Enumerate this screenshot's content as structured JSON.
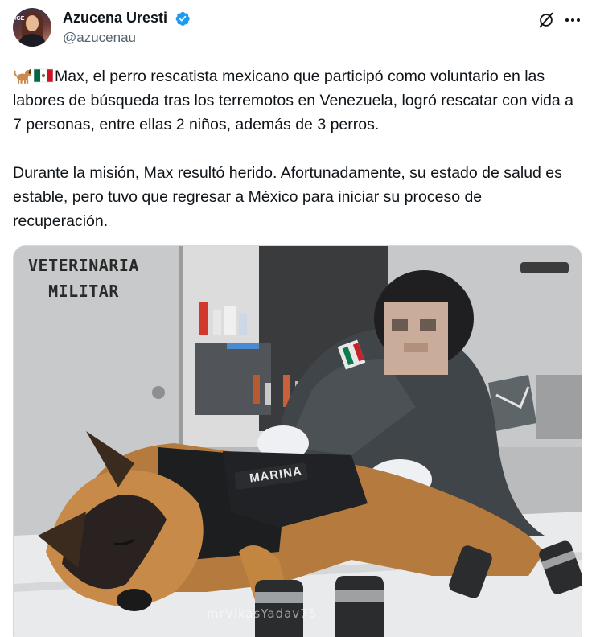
{
  "author": {
    "display_name": "Azucena Uresti",
    "handle": "@azucenau",
    "avatar_tag": "fGE",
    "verified_color": "#1d9bf0"
  },
  "post": {
    "paragraphs": [
      "Max, el perro rescatista mexicano que participó como voluntario en las labores de búsqueda tras los terremotos en Venezuela, logró rescatar con vida a 7 personas, entre ellas 2 niños, además de 3 perros.",
      "Durante la misión, Max resultó herido. Afortunadamente, su estado de salud es estable, pero tuvo que regresar a México para iniciar su proceso de recuperación."
    ],
    "emojis": [
      "dog-emoji",
      "mexico-flag-emoji"
    ]
  },
  "media": {
    "sign_line1": "VETERINARIA",
    "sign_line2": "MILITAR",
    "vest_text": "MARINA",
    "watermark": "mrVikasYadav75"
  },
  "icons": {
    "grok": "grok-icon",
    "more": "more-icon"
  },
  "colors": {
    "text": "#0f1419",
    "secondary": "#536471",
    "accent": "#1d9bf0",
    "border": "#cfd9de"
  }
}
